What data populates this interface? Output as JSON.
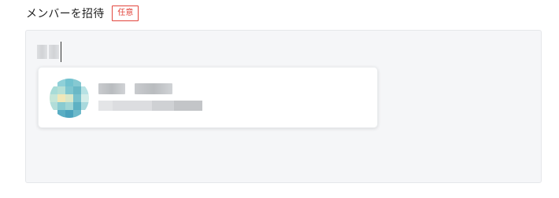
{
  "header": {
    "title": "メンバーを招待",
    "badge": "任意"
  },
  "colors": {
    "badge": "#e2453c",
    "editor_bg": "#f5f6f8",
    "card_bg": "#ffffff"
  },
  "editor": {
    "typed_text_blurred": true
  },
  "suggestion": {
    "avatar_icon": "user-avatar",
    "name_blurred": true,
    "email_blurred": true
  }
}
